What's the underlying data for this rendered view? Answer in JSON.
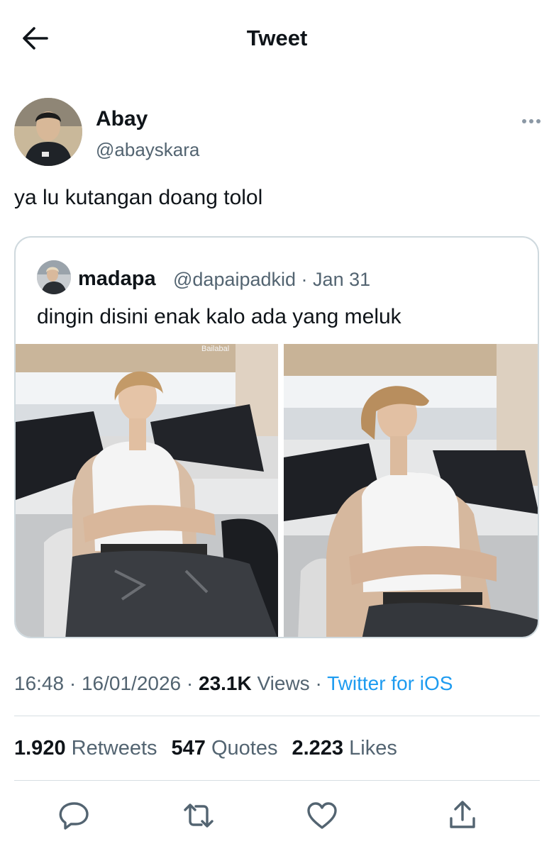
{
  "header": {
    "title": "Tweet",
    "back_icon": "back-arrow-icon"
  },
  "tweet": {
    "author_name": "Abay",
    "author_handle": "@abayskara",
    "text": "ya lu kutangan doang tolol",
    "time": "16:48",
    "date": "16/01/2026",
    "views_count": "23.1K",
    "views_label": "Views",
    "source": "Twitter for iOS"
  },
  "quote": {
    "author_name": "madapa",
    "author_handle": "@dapaipadkid",
    "date": "Jan 31",
    "text": "dingin disini enak kalo ada yang meluk",
    "photo_watermark": "Bailabal"
  },
  "stats": {
    "retweets_count": "1.920",
    "retweets_label": "Retweets",
    "quotes_count": "547",
    "quotes_label": "Quotes",
    "likes_count": "2.223",
    "likes_label": "Likes"
  },
  "actions": [
    "reply-icon",
    "retweet-icon",
    "like-icon",
    "share-icon"
  ],
  "colors": {
    "link": "#1d9bf0",
    "secondary_text": "#536471",
    "border": "#cfd9de"
  }
}
